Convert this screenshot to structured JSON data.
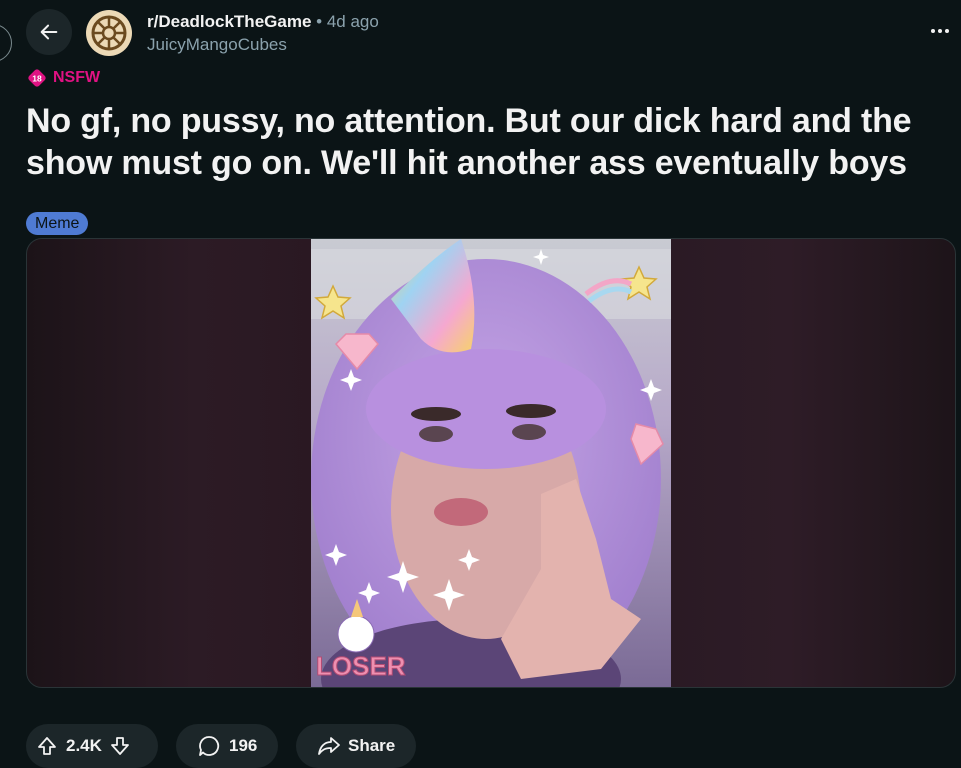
{
  "post": {
    "subreddit": "r/DeadlockTheGame",
    "separator": "•",
    "time_ago": "4d ago",
    "author": "JuicyMangoCubes",
    "nsfw_badge_number": "18",
    "nsfw_label": "NSFW",
    "title": "No gf, no pussy, no attention. But our dick hard and the show must go on. We'll hit another ass eventually boys",
    "flair": "Meme",
    "image_overlay_text": "LOSER"
  },
  "actions": {
    "score": "2.4K",
    "comment_count": "196",
    "share_label": "Share"
  },
  "colors": {
    "background": "#0b1416",
    "nsfw": "#e01283",
    "flair_bg": "#4f7bd3",
    "pill_bg": "#1c2629",
    "muted_text": "#8ba2ad"
  },
  "icons": {
    "back": "arrow-left-icon",
    "more": "ellipsis-icon",
    "upvote": "arrow-up-icon",
    "downvote": "arrow-down-icon",
    "comment": "speech-bubble-icon",
    "share": "share-arrow-icon"
  }
}
